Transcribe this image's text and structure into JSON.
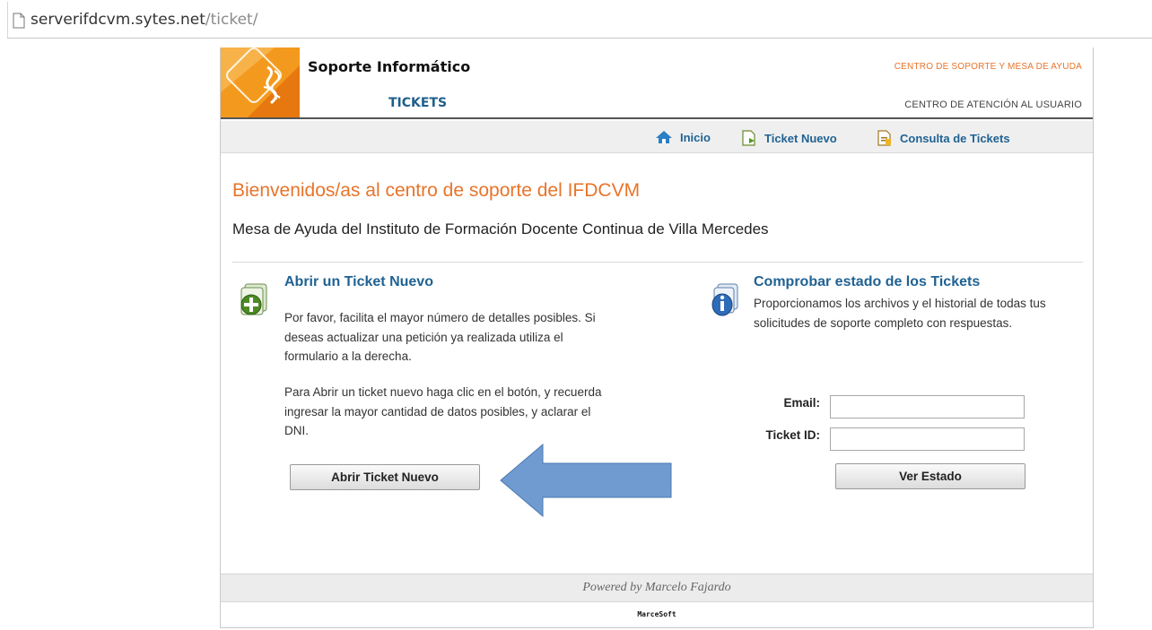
{
  "browser": {
    "url_host": "serverifdcvm.sytes.net",
    "url_path": "/ticket/"
  },
  "header": {
    "brand_title": "Soporte Informático",
    "brand_subtitle": "TICKETS",
    "right_top": "CENTRO DE SOPORTE Y MESA DE AYUDA",
    "right_bottom": "CENTRO DE ATENCIÓN AL USUARIO"
  },
  "nav": {
    "items": [
      {
        "label": "Inicio",
        "icon": "home-icon"
      },
      {
        "label": "Ticket Nuevo",
        "icon": "new-ticket-icon"
      },
      {
        "label": "Consulta de Tickets",
        "icon": "ticket-status-icon"
      }
    ]
  },
  "main": {
    "welcome": "Bienvenidos/as al centro de soporte del IFDCVM",
    "subtitle": "Mesa de Ayuda del Instituto de Formación Docente Continua de Villa Mercedes",
    "left": {
      "title": "Abrir un Ticket Nuevo",
      "para1": "Por favor, facilita el mayor número de detalles posibles. Si deseas actualizar una petición ya realizada utiliza el formulario a la derecha.",
      "para2": "Para Abrir un ticket nuevo haga clic en el botón, y recuerda ingresar la mayor cantidad de datos posibles, y aclarar el DNI.",
      "button": "Abrir Ticket Nuevo"
    },
    "right": {
      "title": "Comprobar estado de los Tickets",
      "para": "Proporcionamos los archivos y el historial de todas tus solicitudes de soporte completo con respuestas.",
      "email_label": "Email:",
      "email_value": "",
      "ticket_label": "Ticket ID:",
      "ticket_value": "",
      "button": "Ver Estado"
    }
  },
  "footer": {
    "powered": "Powered by Marcelo Fajardo",
    "brand": "MarceSoft"
  },
  "colors": {
    "accent_orange": "#e8742a",
    "link_blue": "#1f6293",
    "annotation_arrow": "#6f9bd1"
  }
}
